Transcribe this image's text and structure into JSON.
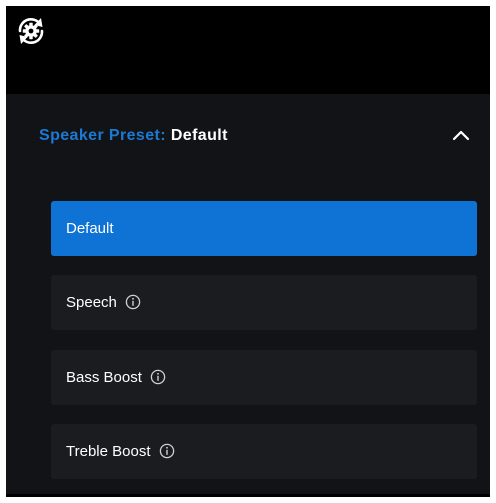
{
  "header": {
    "label": "Speaker Preset:",
    "value": "Default"
  },
  "icons": {
    "top": "settings-sync-icon",
    "collapse": "chevron-up-icon",
    "info": "info-icon"
  },
  "presets": [
    {
      "label": "Default",
      "selected": true,
      "has_info": false
    },
    {
      "label": "Speech",
      "selected": false,
      "has_info": true
    },
    {
      "label": "Bass Boost",
      "selected": false,
      "has_info": true
    },
    {
      "label": "Treble Boost",
      "selected": false,
      "has_info": true
    }
  ],
  "colors": {
    "accent": "#0f73d6",
    "label_blue": "#1a7ad4",
    "panel_bg": "#121316",
    "option_bg": "#1b1c20"
  }
}
